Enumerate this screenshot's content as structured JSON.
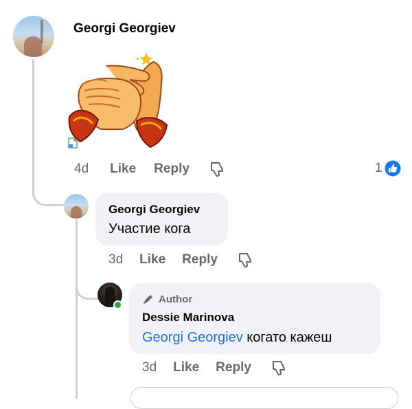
{
  "colors": {
    "accent": "#1877f2",
    "mention": "#216fdb",
    "muted": "#65676b",
    "bubble": "#f0f2f5",
    "online": "#31a24c"
  },
  "comment1": {
    "author": "Georgi Georgiev",
    "attachment": "clapping-hands-sticker",
    "age": "4d",
    "like_label": "Like",
    "reply_label": "Reply",
    "reactions_count": "1",
    "reaction_icon": "like-icon"
  },
  "reply1": {
    "author": "Georgi Georgiev",
    "text": "Участие кога",
    "age": "3d",
    "like_label": "Like",
    "reply_label": "Reply"
  },
  "reply2": {
    "badge": "Author",
    "author": "Dessie Marinova",
    "mention": "Georgi Georgiev",
    "text": " когато кажеш",
    "age": "3d",
    "like_label": "Like",
    "reply_label": "Reply",
    "online": true
  }
}
